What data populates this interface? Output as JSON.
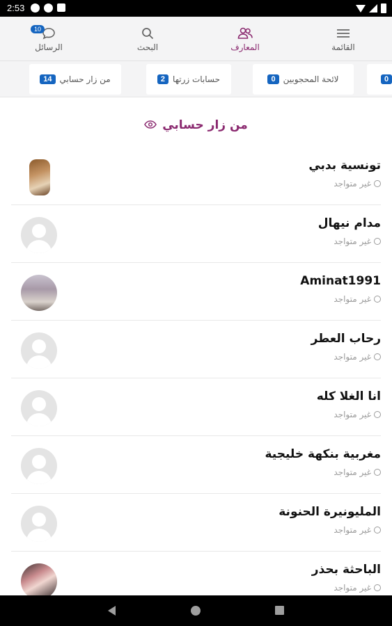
{
  "status_bar": {
    "time": "2:53"
  },
  "top_nav": {
    "items": [
      {
        "label": "القائمة",
        "icon": "menu-icon",
        "active": false
      },
      {
        "label": "المعارف",
        "icon": "people-icon",
        "active": true
      },
      {
        "label": "البحث",
        "icon": "search-icon",
        "active": false
      },
      {
        "label": "الرسائل",
        "icon": "chat-icon",
        "active": false,
        "badge": "10"
      }
    ]
  },
  "tabs": [
    {
      "label": "من زار حسابي",
      "count": "14"
    },
    {
      "label": "حسابات زرتها",
      "count": "2"
    },
    {
      "label": "لائحة المحجوبين",
      "count": "0"
    },
    {
      "label": "",
      "count": "0"
    }
  ],
  "section": {
    "title": "من زار حسابي",
    "icon": "eye-icon",
    "title_color": "#8b2a70"
  },
  "visitors": [
    {
      "name": "تونسية بدبي",
      "status": "غير متواجد",
      "avatar": "photo"
    },
    {
      "name": "مدام نيهال",
      "status": "غير متواجد",
      "avatar": "placeholder"
    },
    {
      "name": "Aminat1991",
      "status": "غير متواجد",
      "avatar": "photo"
    },
    {
      "name": "رحاب العطر",
      "status": "غير متواجد",
      "avatar": "placeholder"
    },
    {
      "name": "انا الغلا كله",
      "status": "غير متواجد",
      "avatar": "placeholder"
    },
    {
      "name": "مغربية بنكهة خليجية",
      "status": "غير متواجد",
      "avatar": "placeholder"
    },
    {
      "name": "المليونيرة الحنونة",
      "status": "غير متواجد",
      "avatar": "placeholder"
    },
    {
      "name": "الباحثة بحذر",
      "status": "غير متواجد",
      "avatar": "photo"
    }
  ],
  "colors": {
    "accent": "#8b2a70",
    "badge": "#1565c0",
    "muted": "#9a9a9a"
  }
}
